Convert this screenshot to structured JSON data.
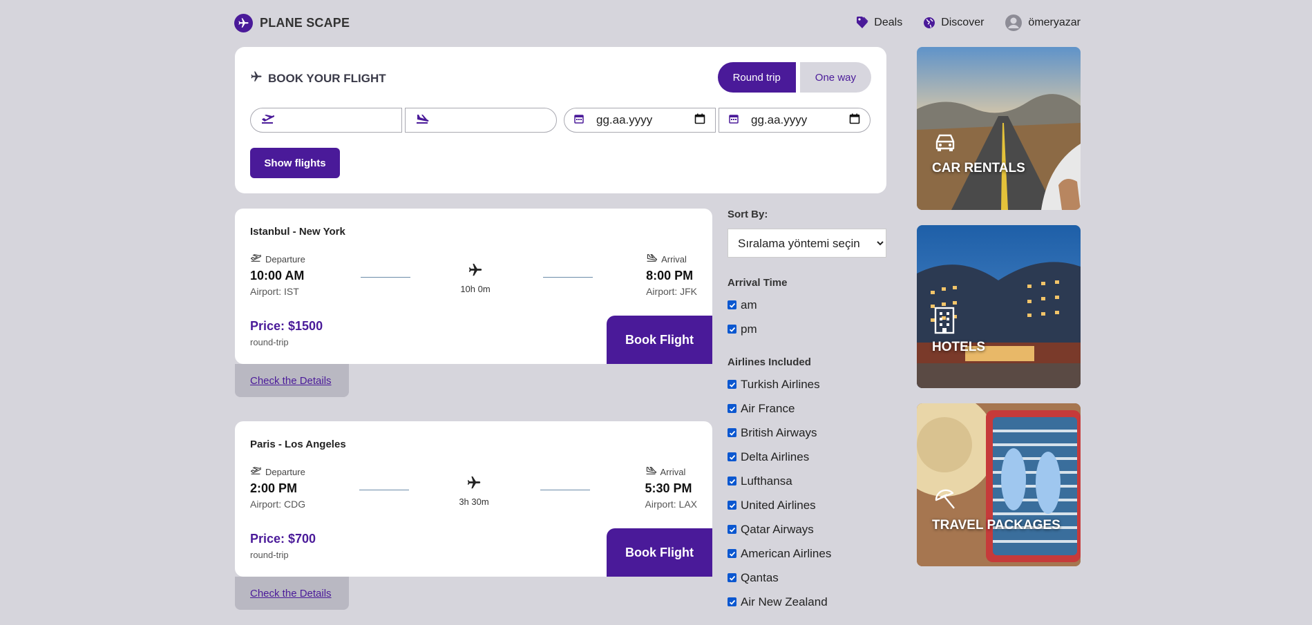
{
  "header": {
    "brand": "PLANE SCAPE",
    "nav": {
      "deals": "Deals",
      "discover": "Discover",
      "user": "ömeryazar"
    }
  },
  "booking": {
    "title": "BOOK YOUR FLIGHT",
    "round_trip": "Round trip",
    "one_way": "One way",
    "from_value": "",
    "to_value": "",
    "depart_date_placeholder": "gg.aa.yyyy",
    "return_date_placeholder": "gg.aa.yyyy",
    "show_flights": "Show flights"
  },
  "flights": [
    {
      "route": "Istanbul - New York",
      "departure_label": "Departure",
      "departure_time": "10:00 AM",
      "departure_airport": "Airport: IST",
      "duration": "10h 0m",
      "arrival_label": "Arrival",
      "arrival_time": "8:00 PM",
      "arrival_airport": "Airport: JFK",
      "price": "Price: $1500",
      "trip_type": "round-trip",
      "book": "Book Flight",
      "details": "Check the Details"
    },
    {
      "route": "Paris - Los Angeles",
      "departure_label": "Departure",
      "departure_time": "2:00 PM",
      "departure_airport": "Airport: CDG",
      "duration": "3h 30m",
      "arrival_label": "Arrival",
      "arrival_time": "5:30 PM",
      "arrival_airport": "Airport: LAX",
      "price": "Price: $700",
      "trip_type": "round-trip",
      "book": "Book Flight",
      "details": "Check the Details"
    }
  ],
  "filters": {
    "sort_title": "Sort By:",
    "sort_selected": "Sıralama yöntemi seçin",
    "arrival_title": "Arrival Time",
    "arrival_options": [
      "am",
      "pm"
    ],
    "airlines_title": "Airlines Included",
    "airlines": [
      "Turkish Airlines",
      "Air France",
      "British Airways",
      "Delta Airlines",
      "Lufthansa",
      "United Airlines",
      "Qatar Airways",
      "American Airlines",
      "Qantas",
      "Air New Zealand"
    ]
  },
  "tiles": {
    "car_rentals": "CAR RENTALS",
    "hotels": "HOTELS",
    "travel_packages": "TRAVEL PACKAGES"
  },
  "colors": {
    "accent": "#4a1a99",
    "background": "#d6d5dc",
    "checkbox": "#0b57d0"
  }
}
